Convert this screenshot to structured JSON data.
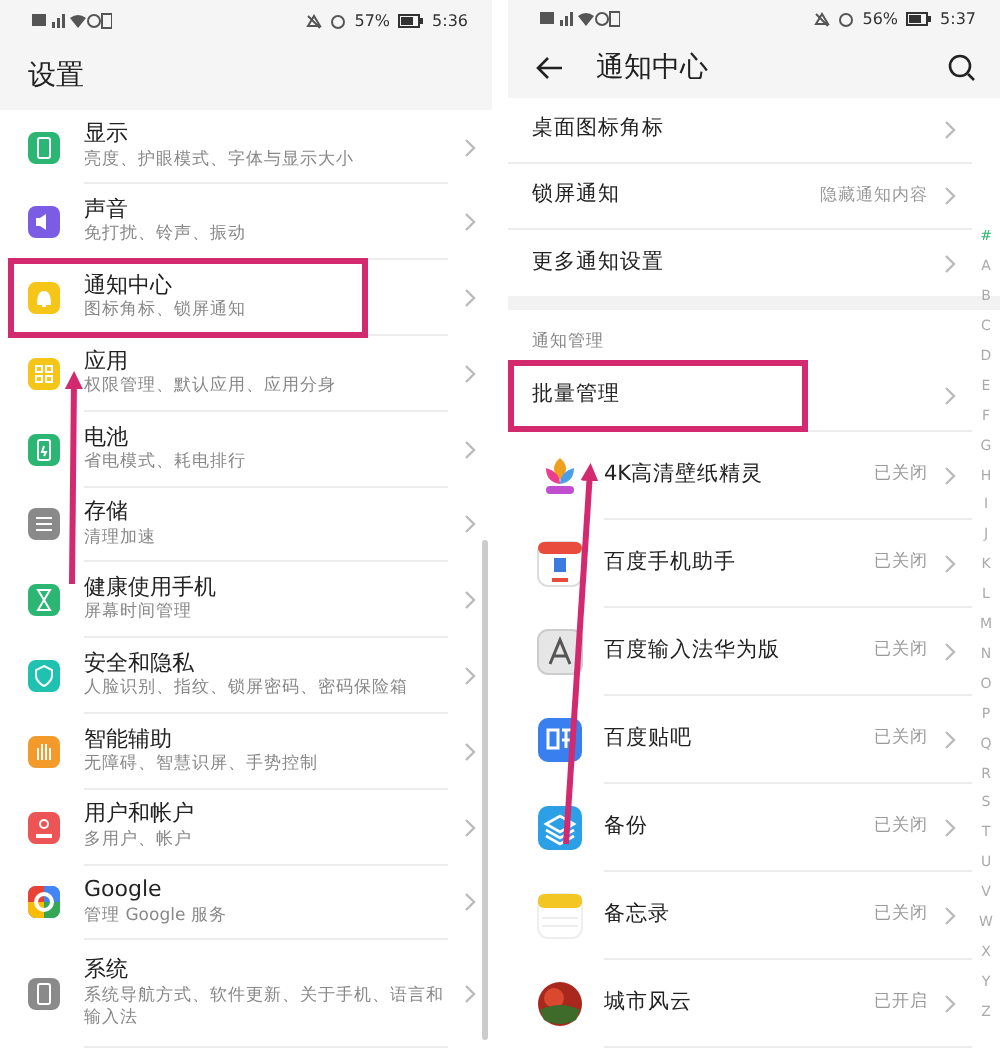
{
  "left_screen": {
    "status_bar": {
      "battery": "57%",
      "time": "5:36"
    },
    "title": "设置",
    "items": [
      {
        "title": "显示",
        "subtitle": "亮度、护眼模式、字体与显示大小",
        "color": "#2bb673",
        "highlighted": false
      },
      {
        "title": "声音",
        "subtitle": "免打扰、铃声、振动",
        "color": "#7b5ce5",
        "highlighted": false
      },
      {
        "title": "通知中心",
        "subtitle": "图标角标、锁屏通知",
        "color": "#f5c518",
        "highlighted": true
      },
      {
        "title": "应用",
        "subtitle": "权限管理、默认应用、应用分身",
        "color": "#f5c518",
        "highlighted": false
      },
      {
        "title": "电池",
        "subtitle": "省电模式、耗电排行",
        "color": "#2bb673",
        "highlighted": false
      },
      {
        "title": "存储",
        "subtitle": "清理加速",
        "color": "#8a8a8a",
        "highlighted": false
      },
      {
        "title": "健康使用手机",
        "subtitle": "屏幕时间管理",
        "color": "#2bb673",
        "highlighted": false
      },
      {
        "title": "安全和隐私",
        "subtitle": "人脸识别、指纹、锁屏密码、密码保险箱",
        "color": "#1fc2b0",
        "highlighted": false
      },
      {
        "title": "智能辅助",
        "subtitle": "无障碍、智慧识屏、手势控制",
        "color": "#f39a2b",
        "highlighted": false
      },
      {
        "title": "用户和帐户",
        "subtitle": "多用户、帐户",
        "color": "#ec5456",
        "highlighted": false
      },
      {
        "title": "Google",
        "subtitle": "管理 Google 服务",
        "color": "#4285f4",
        "highlighted": false
      },
      {
        "title": "系统",
        "subtitle": "系统导航方式、软件更新、关于手机、语言和输入法",
        "color": "#8a8a8a",
        "highlighted": false
      }
    ]
  },
  "right_screen": {
    "status_bar": {
      "battery": "56%",
      "time": "5:37"
    },
    "title": "通知中心",
    "settings": [
      {
        "label": "桌面图标角标"
      },
      {
        "label": "锁屏通知",
        "value": "隐藏通知内容"
      },
      {
        "label": "更多通知设置"
      }
    ],
    "section_label": "通知管理",
    "batch": {
      "label": "批量管理",
      "highlighted": true
    },
    "apps": [
      {
        "name": "4K高清壁纸精灵",
        "status": "已关闭"
      },
      {
        "name": "百度手机助手",
        "status": "已关闭"
      },
      {
        "name": "百度输入法华为版",
        "status": "已关闭"
      },
      {
        "name": "百度贴吧",
        "status": "已关闭"
      },
      {
        "name": "备份",
        "status": "已关闭"
      },
      {
        "name": "备忘录",
        "status": "已关闭"
      },
      {
        "name": "城市风云",
        "status": "已开启"
      }
    ],
    "index_letters": [
      "#",
      "A",
      "B",
      "C",
      "D",
      "E",
      "F",
      "G",
      "H",
      "I",
      "J",
      "K",
      "L",
      "M",
      "N",
      "O",
      "P",
      "Q",
      "R",
      "S",
      "T",
      "U",
      "V",
      "W",
      "X",
      "Y",
      "Z"
    ]
  }
}
